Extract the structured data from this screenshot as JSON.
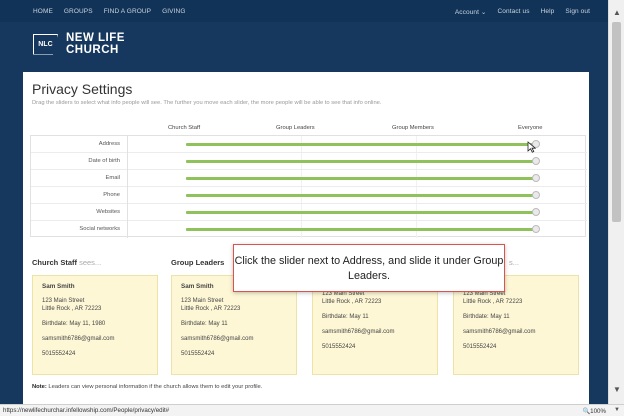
{
  "topnav": {
    "left": [
      "HOME",
      "GROUPS",
      "FIND A GROUP",
      "GIVING"
    ],
    "right": [
      "Account ⌄",
      "Contact us",
      "Help",
      "Sign out"
    ]
  },
  "logo": {
    "badge": "NLC",
    "line1": "NEW LIFE",
    "line2": "CHURCH"
  },
  "page": {
    "title": "Privacy Settings",
    "subtitle": "Drag the sliders to select what info people will see. The further you move each slider, the more people will be able to see that info online."
  },
  "columns": [
    "Church Staff",
    "Group Leaders",
    "Group Members",
    "Everyone"
  ],
  "rows": [
    {
      "label": "Address",
      "level": "Everyone"
    },
    {
      "label": "Date of birth",
      "level": "Everyone"
    },
    {
      "label": "Email",
      "level": "Everyone"
    },
    {
      "label": "Phone",
      "level": "Everyone"
    },
    {
      "label": "Websites",
      "level": "Everyone"
    },
    {
      "label": "Social networks",
      "level": "Everyone"
    }
  ],
  "sees": [
    {
      "who": "Church Staff",
      "suffix": " sees..."
    },
    {
      "who": "Group Leaders",
      "suffix": ""
    },
    {
      "who": "",
      "suffix": ""
    },
    {
      "who": "",
      "suffix": "s..."
    }
  ],
  "cards": [
    {
      "name": "Sam Smith",
      "street": "123 Main Street",
      "city": "Little Rock , AR  72223",
      "birth": "Birthdate: May 11, 1980",
      "email": "samsmith6786@gmail.com",
      "phone": "5015552424"
    },
    {
      "name": "Sam Smith",
      "street": "123 Main Street",
      "city": "Little Rock , AR  72223",
      "birth": "Birthdate: May 11",
      "email": "samsmith6786@gmail.com",
      "phone": "5015552424"
    },
    {
      "name": "",
      "street": "123 Main Street",
      "city": "Little Rock , AR  72223",
      "birth": "Birthdate: May 11",
      "email": "samsmith6786@gmail.com",
      "phone": "5015552424"
    },
    {
      "name": "",
      "street": "123 Main Street",
      "city": "Little Rock , AR  72223",
      "birth": "Birthdate: May 11",
      "email": "samsmith6786@gmail.com",
      "phone": "5015552424"
    }
  ],
  "note": {
    "bold": "Note:",
    "text": " Leaders can view personal information if the church allows them to edit your profile."
  },
  "callout": "Click the slider next to Address, and slide it under Group Leaders.",
  "status": {
    "url": "https://newlifechurchar.infellowship.com/People/privacy/edit#",
    "zoom": "🔍100%"
  },
  "colors": {
    "nav": "#123358",
    "track": "#8fc25a",
    "card": "#fdf7d6",
    "callout_border": "#d9534f"
  }
}
